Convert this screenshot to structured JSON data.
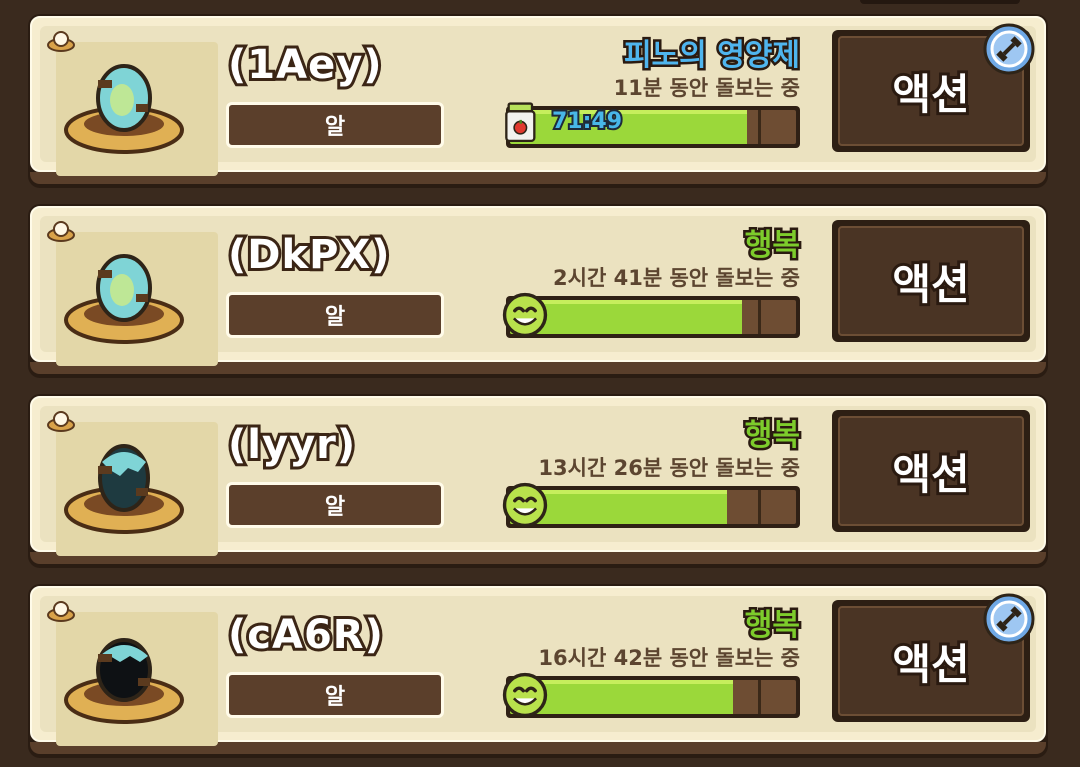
{
  "colors": {
    "card_background": "#f6edcf",
    "card_border_dark": "#2a1c12",
    "button_brown": "#4a3424",
    "bar_green": "#9bd83a",
    "status_blue": "#4fb5ee",
    "status_green": "#7dcc2c"
  },
  "pets": [
    {
      "name": "(1Aey)",
      "type_label": "알",
      "status_title": "피노의 영양제",
      "status_color": "blue",
      "care_text": "11분 동안 돌보는 중",
      "bar_icon": "supplement-jar-icon",
      "bar_label": "71:49",
      "bar_fill": 0.83,
      "action_label": "액션",
      "has_badge": true,
      "badge_icon": "dumbbell-badge-icon"
    },
    {
      "name": "(DkPX)",
      "type_label": "알",
      "status_title": "행복",
      "status_color": "green",
      "care_text": "2시간 41분 동안 돌보는 중",
      "bar_icon": "smiley-face-icon",
      "bar_label": "",
      "bar_fill": 0.81,
      "action_label": "액션",
      "has_badge": false
    },
    {
      "name": "(lyyr)",
      "type_label": "알",
      "status_title": "행복",
      "status_color": "green",
      "care_text": "13시간 26분 동안 돌보는 중",
      "bar_icon": "smiley-face-icon",
      "bar_label": "",
      "bar_fill": 0.76,
      "action_label": "액션",
      "has_badge": false
    },
    {
      "name": "(cA6R)",
      "type_label": "알",
      "status_title": "행복",
      "status_color": "green",
      "care_text": "16시간 42분 동안 돌보는 중",
      "bar_icon": "smiley-face-icon",
      "bar_label": "",
      "bar_fill": 0.78,
      "action_label": "액션",
      "has_badge": true,
      "badge_icon": "dumbbell-badge-icon"
    }
  ]
}
